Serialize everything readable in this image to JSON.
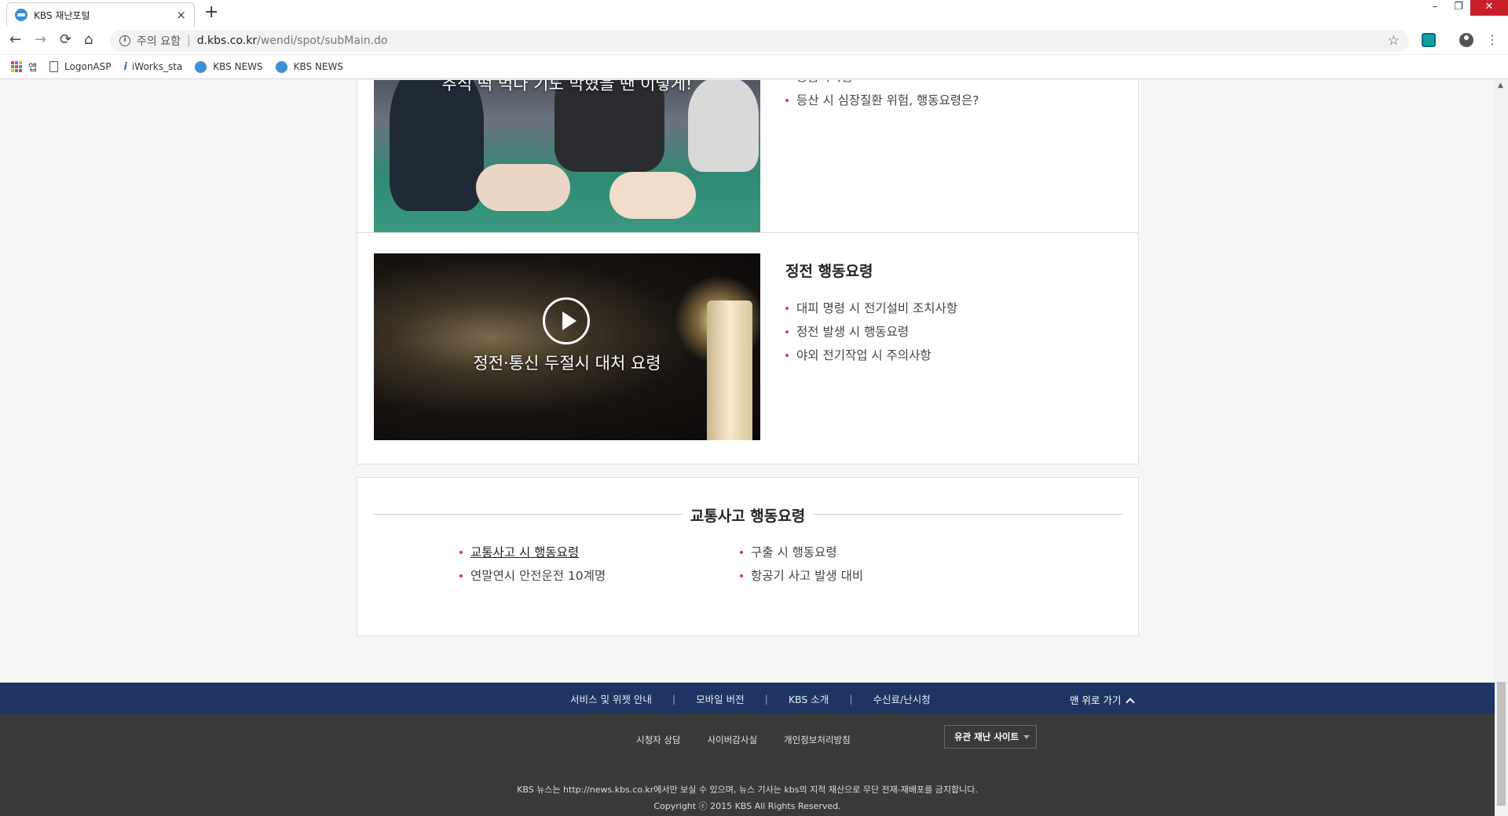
{
  "browser": {
    "tab_title": "KBS 재난포털",
    "tab_close": "×",
    "new_tab": "+",
    "window_controls": [
      "–",
      "❐",
      "✕"
    ],
    "nav": {
      "back": "←",
      "forward": "→",
      "reload": "⟳",
      "home": "⌂"
    },
    "address": {
      "security_label": "주의 요함",
      "separator": "|",
      "host": "d.kbs.co.kr",
      "path": "/wendi/spot/subMain.do",
      "star": "☆"
    },
    "menu": "⋮",
    "bookmarks": [
      {
        "label": "앱",
        "icon": "apps-grid-icon"
      },
      {
        "label": "LogonASP",
        "icon": "page-icon"
      },
      {
        "label": "iWorks_sta",
        "icon": "iworks-icon"
      },
      {
        "label": "KBS NEWS",
        "icon": "kbs-icon"
      },
      {
        "label": "KBS NEWS",
        "icon": "kbs-icon"
      }
    ]
  },
  "cards": {
    "first_aid": {
      "thumb_caption": "추석 떡 먹다 기도 막혔을 땐 이렇게!",
      "items": [
        "응급처치법",
        "등산 시 심장질환 위험, 행동요령은?"
      ]
    },
    "blackout": {
      "thumb_caption": "정전·통신 두절시 대처 요령",
      "title": "정전 행동요령",
      "items": [
        "대피 명령 시 전기설비 조치사항",
        "정전 발생 시 행동요령",
        "야외 전기작업 시 주의사항"
      ]
    },
    "traffic": {
      "title": "교통사고 행동요령",
      "left_items": [
        "교통사고 시 행동요령",
        "연말연시 안전운전 10계명"
      ],
      "right_items": [
        "구출 시 행동요령",
        "항공기 사고 발생 대비"
      ]
    }
  },
  "footer": {
    "nav_links": [
      "서비스 및 위젯 안내",
      "모바일 버전",
      "KBS 소개",
      "수신료/난시청"
    ],
    "nav_sep": "|",
    "to_top": "맨 위로 가기",
    "links": [
      "시청자 상담",
      "사이버감사실",
      "개인정보처리방침"
    ],
    "related_sites": "유관 재난 사이트",
    "notice": "KBS 뉴스는 http://news.kbs.co.kr에서만 보실 수 있으며, 뉴스 기사는 kbs의 지적 재산으로 무단 전재-재배포를 금지합니다.",
    "copyright": "Copyright ⓒ 2015 KBS All Rights Reserved."
  },
  "colors": {
    "bullet": "#e3343d",
    "footer_nav_bg": "#1e3564",
    "footer_bg": "#3a3a3a"
  }
}
